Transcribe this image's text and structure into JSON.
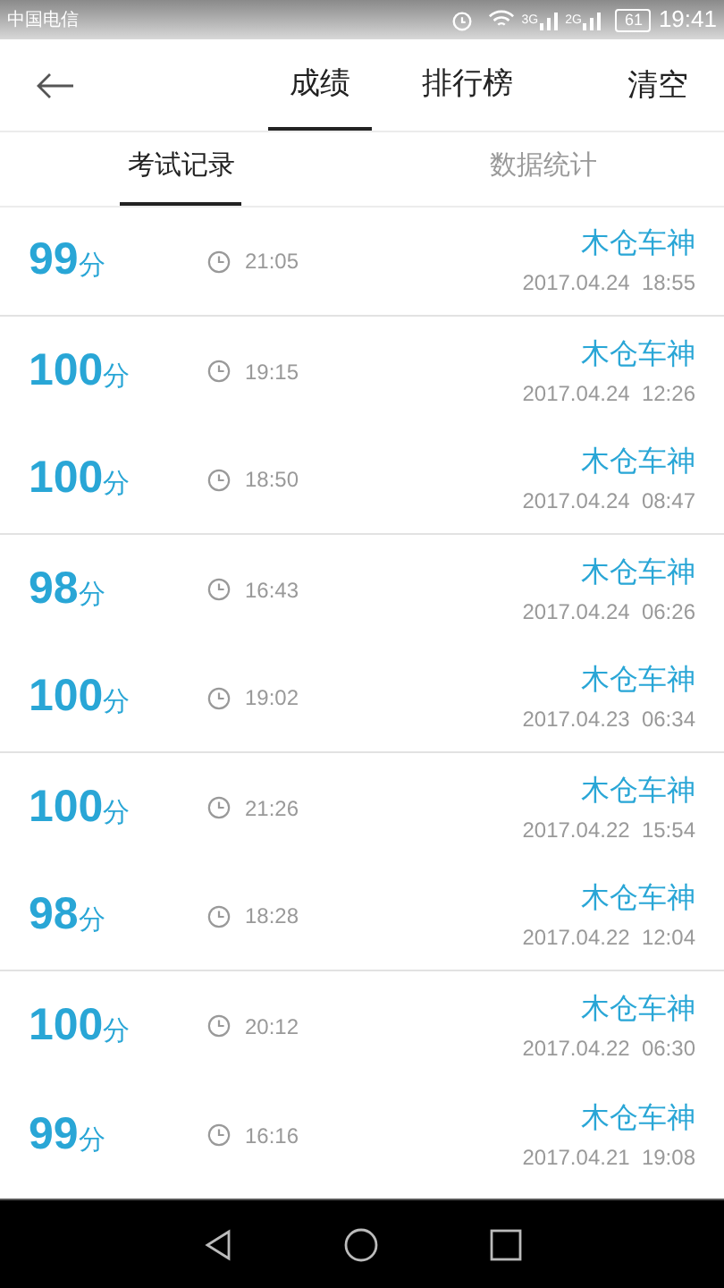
{
  "status_bar": {
    "carrier": "中国电信",
    "network_1": "3G",
    "network_2": "2G",
    "battery": "61",
    "time": "19:41"
  },
  "header": {
    "tabs": [
      {
        "label": "成绩",
        "selected": true
      },
      {
        "label": "排行榜",
        "selected": false
      }
    ],
    "action": "清空"
  },
  "sub_tabs": [
    {
      "label": "考试记录",
      "selected": true
    },
    {
      "label": "数据统计",
      "selected": false
    }
  ],
  "records": [
    {
      "score": "99",
      "unit": "分",
      "duration": "21:05",
      "name": "木仓车神",
      "date": "2017.04.24  18:55",
      "divider": true
    },
    {
      "score": "100",
      "unit": "分",
      "duration": "19:15",
      "name": "木仓车神",
      "date": "2017.04.24  12:26",
      "divider": false
    },
    {
      "score": "100",
      "unit": "分",
      "duration": "18:50",
      "name": "木仓车神",
      "date": "2017.04.24  08:47",
      "divider": true
    },
    {
      "score": "98",
      "unit": "分",
      "duration": "16:43",
      "name": "木仓车神",
      "date": "2017.04.24  06:26",
      "divider": false
    },
    {
      "score": "100",
      "unit": "分",
      "duration": "19:02",
      "name": "木仓车神",
      "date": "2017.04.23  06:34",
      "divider": true
    },
    {
      "score": "100",
      "unit": "分",
      "duration": "21:26",
      "name": "木仓车神",
      "date": "2017.04.22  15:54",
      "divider": false
    },
    {
      "score": "98",
      "unit": "分",
      "duration": "18:28",
      "name": "木仓车神",
      "date": "2017.04.22  12:04",
      "divider": true
    },
    {
      "score": "100",
      "unit": "分",
      "duration": "20:12",
      "name": "木仓车神",
      "date": "2017.04.22  06:30",
      "divider": false
    },
    {
      "score": "99",
      "unit": "分",
      "duration": "16:16",
      "name": "木仓车神",
      "date": "2017.04.21  19:08",
      "divider": false
    }
  ]
}
